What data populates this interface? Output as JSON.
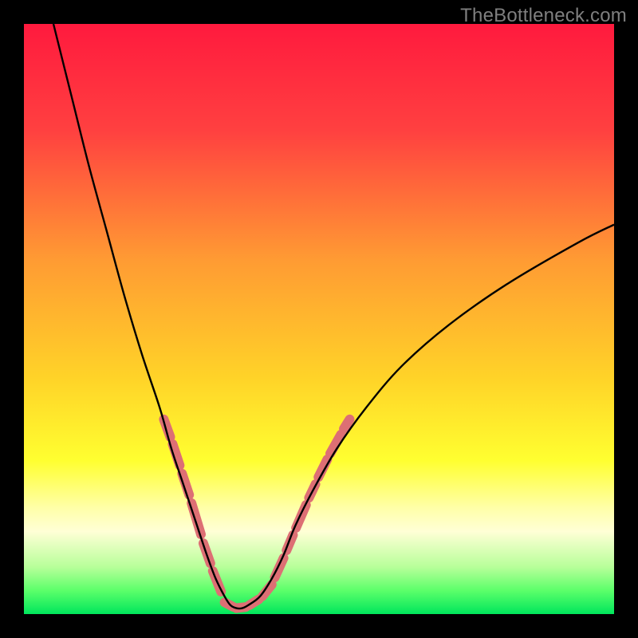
{
  "watermark": "TheBottleneck.com",
  "chart_data": {
    "type": "line",
    "title": "",
    "xlabel": "",
    "ylabel": "",
    "xlim": [
      0,
      100
    ],
    "ylim": [
      0,
      100
    ],
    "grid": false,
    "legend": false,
    "gradient_stops": [
      {
        "offset": 0.0,
        "color": "#ff1a3e"
      },
      {
        "offset": 0.18,
        "color": "#ff4040"
      },
      {
        "offset": 0.4,
        "color": "#ff9b33"
      },
      {
        "offset": 0.6,
        "color": "#ffd328"
      },
      {
        "offset": 0.74,
        "color": "#ffff30"
      },
      {
        "offset": 0.82,
        "color": "#ffffa8"
      },
      {
        "offset": 0.86,
        "color": "#ffffd6"
      },
      {
        "offset": 0.92,
        "color": "#b8ff9a"
      },
      {
        "offset": 0.96,
        "color": "#5cff6a"
      },
      {
        "offset": 1.0,
        "color": "#00e65c"
      }
    ],
    "series": [
      {
        "name": "bottleneck-curve",
        "color": "#000000",
        "x": [
          5,
          8,
          11,
          14,
          17,
          20,
          23,
          25,
          27,
          29,
          31,
          32.5,
          34,
          35,
          36,
          37,
          38,
          40,
          42,
          44,
          46,
          49,
          53,
          58,
          64,
          72,
          82,
          94,
          100
        ],
        "y": [
          100,
          88,
          76,
          65,
          54,
          44,
          35,
          28,
          22,
          16,
          10,
          6,
          3,
          1.5,
          1,
          1,
          1.5,
          3,
          6,
          10,
          15,
          21,
          28,
          35,
          42,
          49,
          56,
          63,
          66
        ]
      }
    ],
    "dash_segments": {
      "color": "#dd6f74",
      "width": 12,
      "left": [
        {
          "x1": 23.7,
          "y1": 33.0,
          "x2": 24.8,
          "y2": 30.0
        },
        {
          "x1": 25.2,
          "y1": 28.8,
          "x2": 26.4,
          "y2": 25.2
        },
        {
          "x1": 26.8,
          "y1": 23.8,
          "x2": 28.0,
          "y2": 20.2
        },
        {
          "x1": 28.4,
          "y1": 18.8,
          "x2": 30.0,
          "y2": 13.5
        },
        {
          "x1": 30.4,
          "y1": 12.0,
          "x2": 31.6,
          "y2": 8.6
        },
        {
          "x1": 32.0,
          "y1": 7.3,
          "x2": 33.4,
          "y2": 3.8
        }
      ],
      "bottom": [
        {
          "x1": 34.0,
          "y1": 2.0,
          "x2": 35.5,
          "y2": 1.2
        },
        {
          "x1": 36.0,
          "y1": 1.0,
          "x2": 37.6,
          "y2": 1.2
        },
        {
          "x1": 38.2,
          "y1": 1.5,
          "x2": 39.8,
          "y2": 2.5
        },
        {
          "x1": 40.4,
          "y1": 3.0,
          "x2": 42.0,
          "y2": 5.0
        }
      ],
      "right": [
        {
          "x1": 42.5,
          "y1": 6.2,
          "x2": 44.0,
          "y2": 9.5
        },
        {
          "x1": 44.5,
          "y1": 10.8,
          "x2": 45.6,
          "y2": 13.4
        },
        {
          "x1": 46.1,
          "y1": 14.6,
          "x2": 47.8,
          "y2": 18.5
        },
        {
          "x1": 48.3,
          "y1": 19.7,
          "x2": 49.4,
          "y2": 22.0
        },
        {
          "x1": 49.9,
          "y1": 23.2,
          "x2": 51.4,
          "y2": 26.2
        },
        {
          "x1": 51.9,
          "y1": 27.2,
          "x2": 53.7,
          "y2": 30.4
        },
        {
          "x1": 54.2,
          "y1": 31.4,
          "x2": 55.2,
          "y2": 33.0
        }
      ]
    }
  }
}
